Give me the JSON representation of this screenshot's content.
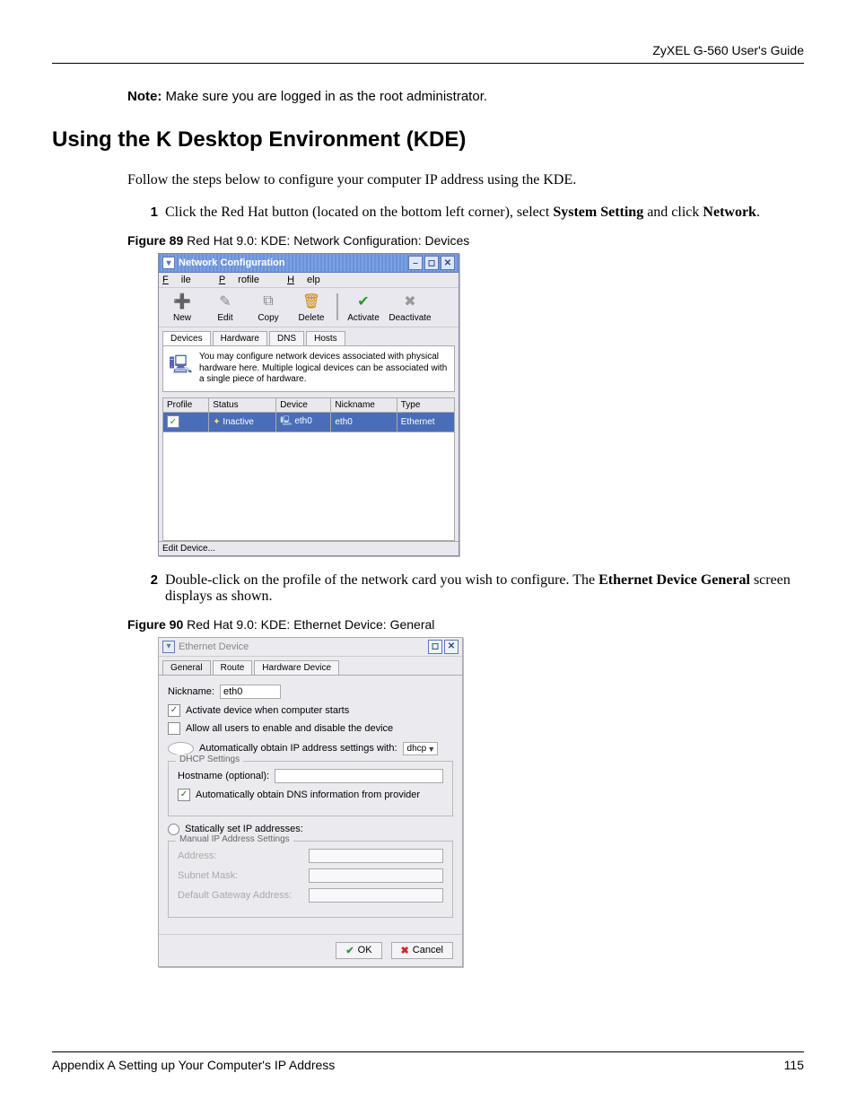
{
  "header": {
    "doc_title": "ZyXEL G-560 User's Guide"
  },
  "note": {
    "label": "Note:",
    "text": " Make sure you are logged in as the root administrator."
  },
  "section_title": "Using the K Desktop Environment (KDE)",
  "intro": "Follow the steps below to configure your computer IP address using the KDE.",
  "step1": {
    "num": "1",
    "t1": "Click the Red Hat button (located on the bottom left corner), select ",
    "b1": "System Setting",
    "t2": " and click ",
    "b2": "Network",
    "t3": "."
  },
  "fig89": {
    "label": "Figure 89",
    "caption": "   Red Hat 9.0: KDE: Network Configuration: Devices"
  },
  "win1": {
    "title": "Network Configuration",
    "menu": {
      "file_u": "F",
      "file": "ile",
      "profile_u": "P",
      "profile": "rofile",
      "help_u": "H",
      "help": "elp"
    },
    "tool": {
      "new": "New",
      "edit": "Edit",
      "copy": "Copy",
      "delete": "Delete",
      "activate": "Activate",
      "deactivate": "Deactivate",
      "new_u": "N",
      "edit_u": "E",
      "copy_u": "C",
      "delete_u": "D",
      "activate_u": "A",
      "deactivate_u": "D"
    },
    "tabs": {
      "devices": "Devices",
      "hardware": "Hardware",
      "hardware_u": "w",
      "dns": "DNS",
      "dns_u": "N",
      "hosts": "Hosts",
      "hosts_u": "o"
    },
    "info": "You may configure network devices associated with physical hardware here.  Multiple logical devices can be associated with a single piece of hardware.",
    "cols": {
      "profile": "Profile",
      "status": "Status",
      "device": "Device",
      "nickname": "Nickname",
      "type": "Type"
    },
    "row": {
      "status": "Inactive",
      "device": "eth0",
      "nickname": "eth0",
      "type": "Ethernet"
    },
    "statusbar": "Edit Device..."
  },
  "step2": {
    "num": "2",
    "t1": "Double-click on the profile of the network card you wish to configure. The ",
    "b1": "Ethernet Device General",
    "t2": " screen displays as shown."
  },
  "fig90": {
    "label": "Figure 90",
    "caption": "   Red Hat 9.0: KDE: Ethernet Device: General"
  },
  "win2": {
    "title": "Ethernet Device",
    "tabs": {
      "general": "General",
      "general_u": "G",
      "route": "Route",
      "route_u": "R",
      "hardware": "Hardware Device",
      "hardware_u": "H"
    },
    "nickname_lbl": "Nickname:",
    "nickname_val": "eth0",
    "chk_activate": "Activate device when computer starts",
    "chk_activate_u": "A",
    "chk_allow": "Allow all users to enable and disable the device",
    "chk_allow_u": "u",
    "radio_auto": "Automatically obtain IP address settings with:",
    "radio_auto_u": "I",
    "dhcp": "dhcp",
    "fs1_legend": "DHCP Settings",
    "hostname_lbl": "Hostname (optional):",
    "hostname_u": "H",
    "chk_dns": "Automatically obtain DNS information from provider",
    "chk_dns_u": "D",
    "radio_static": "Statically set IP addresses:",
    "fs2_legend": "Manual IP Address Settings",
    "addr_lbl": "Address:",
    "addr_u": "A",
    "mask_lbl": "Subnet Mask:",
    "mask_u": "S",
    "gw_lbl": "Default Gateway Address:",
    "gw_u": "G",
    "ok": "OK",
    "ok_u": "O",
    "cancel": "Cancel",
    "cancel_u": "C"
  },
  "footer": {
    "left": "Appendix A Setting up Your Computer's IP Address",
    "right": "115"
  }
}
